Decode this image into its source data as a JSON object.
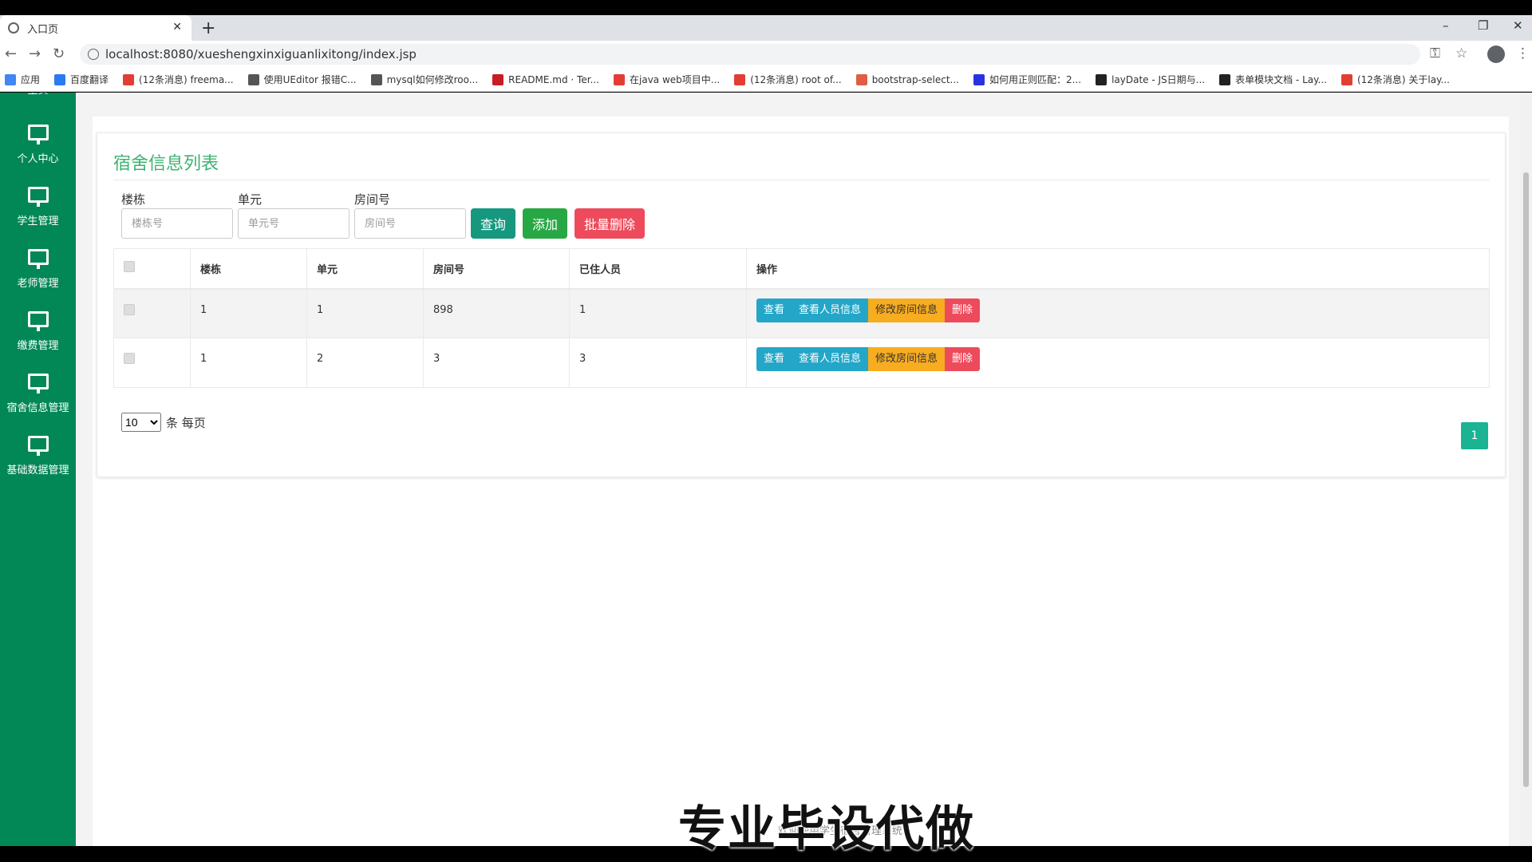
{
  "browser": {
    "tab_title": "入口页",
    "url": "localhost:8080/xueshengxinxiguanlixitong/index.jsp",
    "bookmarks": [
      {
        "label": "应用",
        "color": "#4285f4"
      },
      {
        "label": "百度翻译",
        "color": "#2b7bf0"
      },
      {
        "label": "(12条消息) freema...",
        "color": "#e33e33"
      },
      {
        "label": "使用UEditor 报错C...",
        "color": "#555555"
      },
      {
        "label": "mysql如何修改roo...",
        "color": "#555555"
      },
      {
        "label": "README.md · Ter...",
        "color": "#c71d23"
      },
      {
        "label": "在java web项目中...",
        "color": "#e33e33"
      },
      {
        "label": "(12条消息) root of...",
        "color": "#e33e33"
      },
      {
        "label": "bootstrap-select...",
        "color": "#e05d44"
      },
      {
        "label": "如何用正则匹配：2...",
        "color": "#2932e1"
      },
      {
        "label": "layDate - JS日期与...",
        "color": "#222222"
      },
      {
        "label": "表单模块文档 - Lay...",
        "color": "#222222"
      },
      {
        "label": "(12条消息) 关于lay...",
        "color": "#e33e33"
      }
    ]
  },
  "sidebar": {
    "partial_item": "主页",
    "items": [
      {
        "label": "个人中心"
      },
      {
        "label": "学生管理"
      },
      {
        "label": "老师管理"
      },
      {
        "label": "缴费管理"
      },
      {
        "label": "宿舍信息管理"
      },
      {
        "label": "基础数据管理"
      }
    ]
  },
  "panel": {
    "title": "宿舍信息列表",
    "filters": {
      "building_label": "楼栋",
      "building_placeholder": "楼栋号",
      "unit_label": "单元",
      "unit_placeholder": "单元号",
      "room_label": "房间号",
      "room_placeholder": "房间号"
    },
    "buttons": {
      "query": "查询",
      "add": "添加",
      "batch_delete": "批量删除"
    },
    "table": {
      "headers": [
        "楼栋",
        "单元",
        "房间号",
        "已住人员",
        "操作"
      ],
      "rows": [
        {
          "building": "1",
          "unit": "1",
          "room": "898",
          "residents": "1"
        },
        {
          "building": "1",
          "unit": "2",
          "room": "3",
          "residents": "3"
        }
      ],
      "row_actions": {
        "view": "查看",
        "view_people": "查看人员信息",
        "edit_room": "修改房间信息",
        "delete": "删除"
      }
    },
    "pagination": {
      "page_size": "10",
      "page_size_suffix": "条 每页",
      "current_page": "1"
    }
  },
  "overlay": {
    "watermark": "专业毕设代做",
    "footer_partial": "欢迎使用学生宿舍管理系统"
  },
  "colors": {
    "sidebar": "#028757",
    "title": "#3cb371",
    "query_btn": "#16987e",
    "add_btn": "#27a844",
    "delete_btn": "#ed4b5c",
    "info_btn": "#23a6c8",
    "warn_btn": "#f8ac20"
  }
}
